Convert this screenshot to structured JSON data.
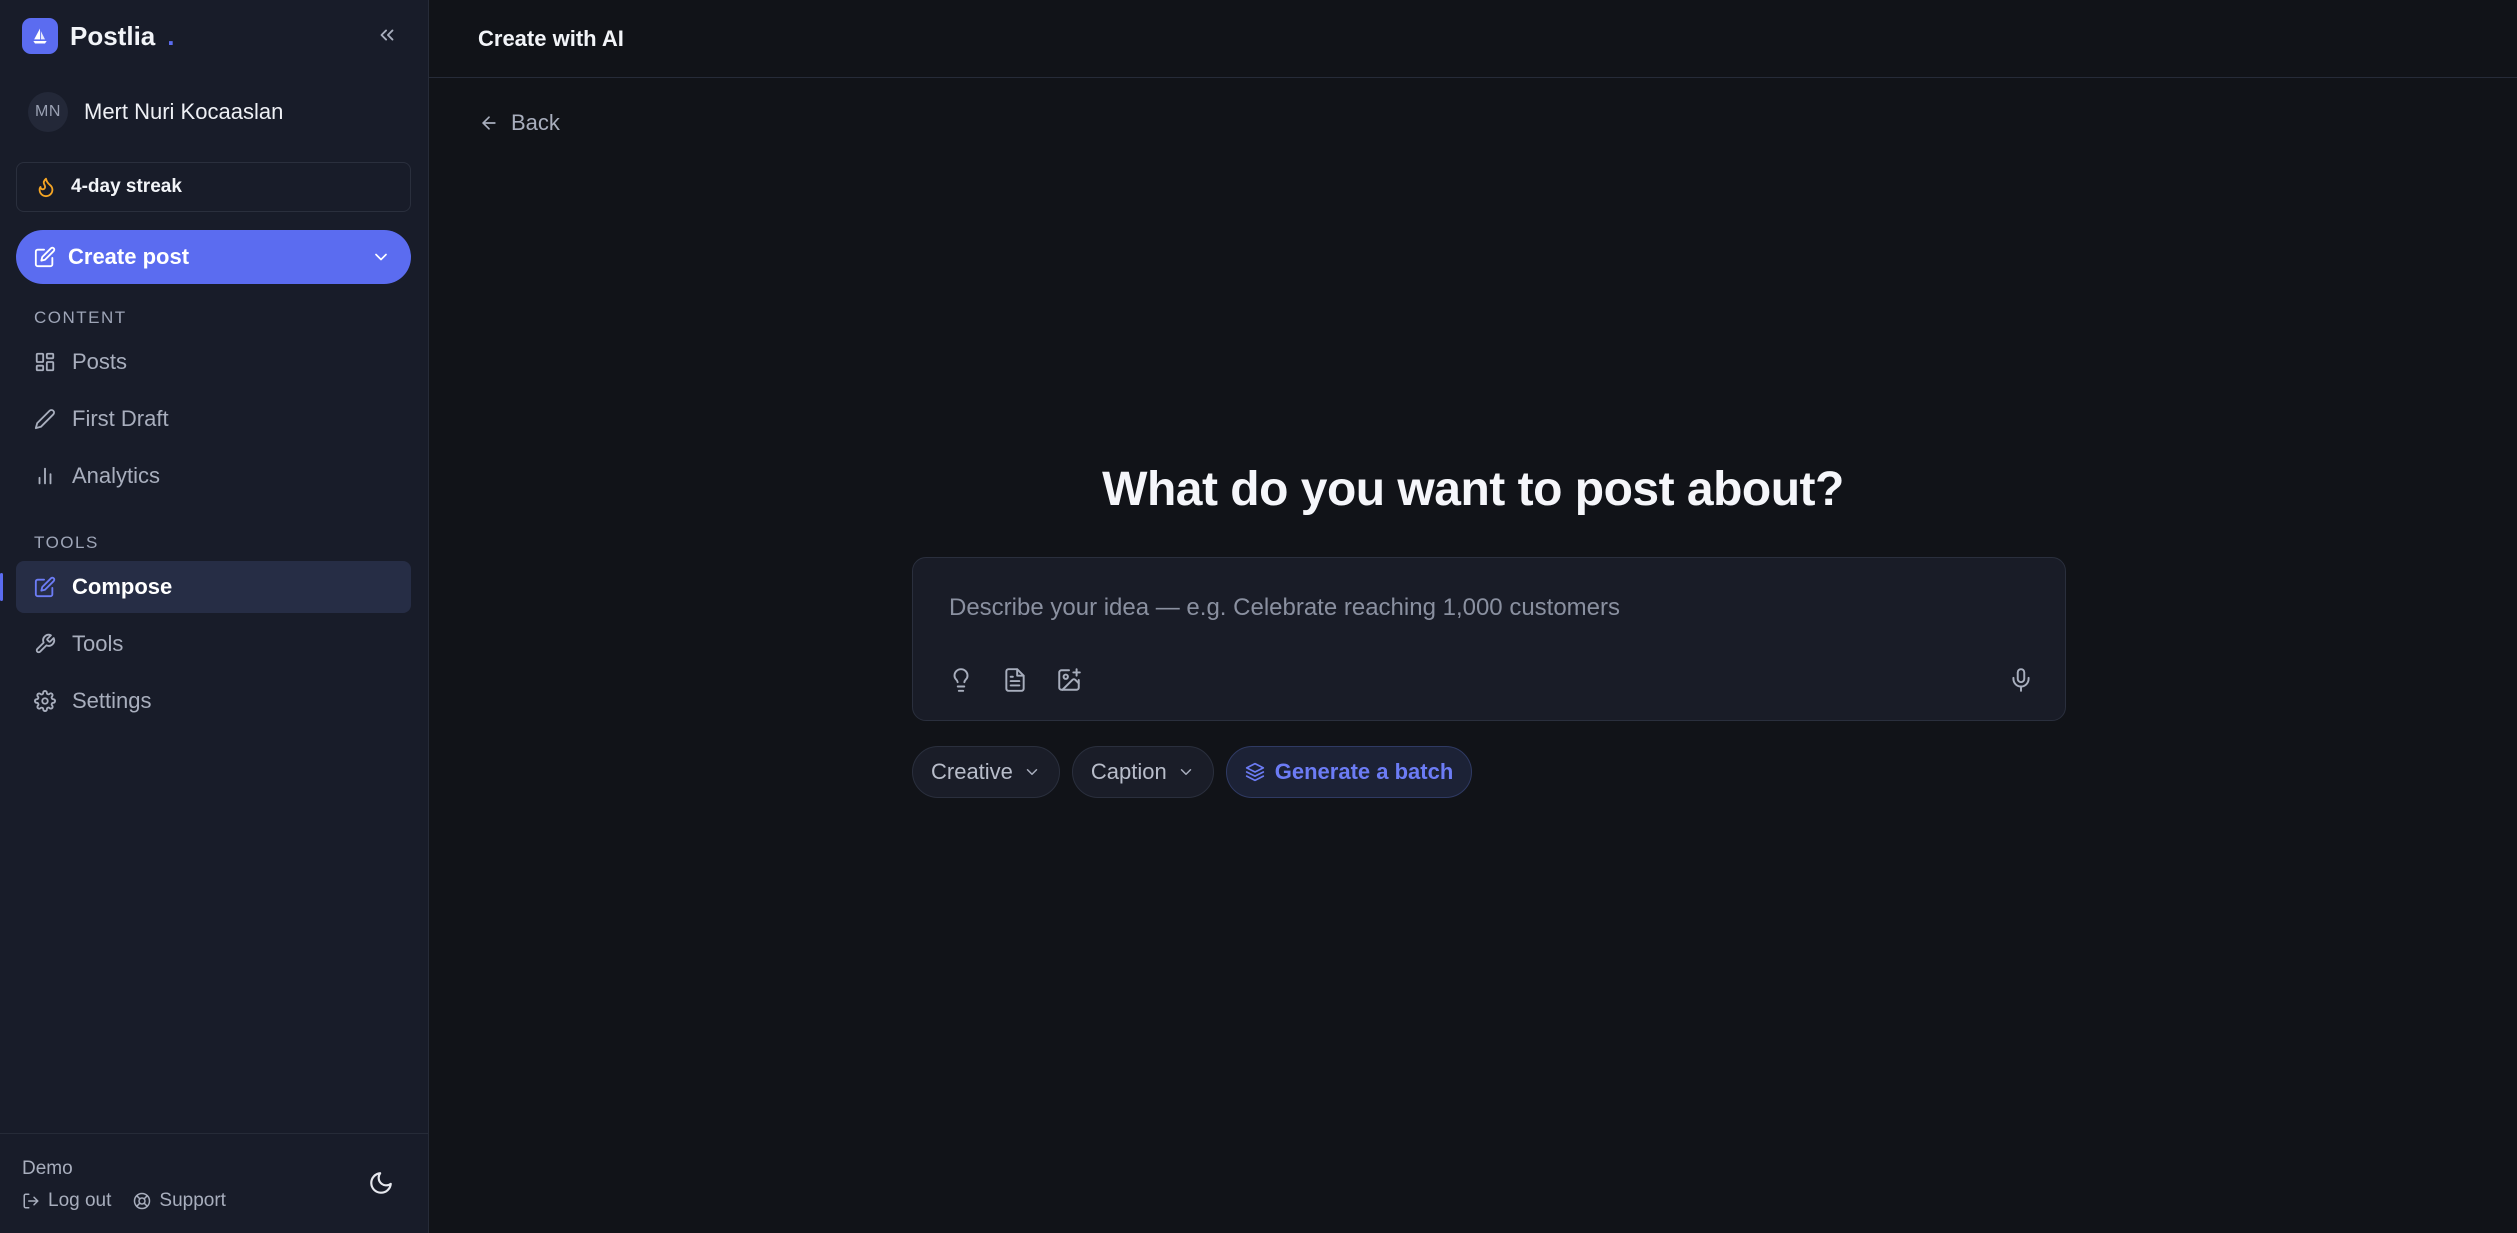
{
  "sidebar": {
    "brand_name": "Postlia",
    "brand_dot": ".",
    "user": {
      "initials": "MN",
      "name": "Mert Nuri Kocaaslan"
    },
    "streak_label": "4-day streak",
    "create_label": "Create post",
    "sections": [
      {
        "label": "CONTENT"
      },
      {
        "label": "TOOLS"
      }
    ],
    "items": [
      {
        "label": "Posts",
        "icon": "grid-icon"
      },
      {
        "label": "First Draft",
        "icon": "pencil-icon"
      },
      {
        "label": "Analytics",
        "icon": "bar-chart-icon"
      },
      {
        "label": "Compose",
        "icon": "edit-icon",
        "active": true
      },
      {
        "label": "Tools",
        "icon": "wrench-icon"
      },
      {
        "label": "Settings",
        "icon": "gear-icon"
      }
    ],
    "footer": {
      "plan": "Demo",
      "logout": "Log out",
      "support": "Support"
    }
  },
  "header": {
    "title": "Create with AI"
  },
  "main": {
    "back_label": "Back",
    "headline": "What do you want to post about?",
    "composer": {
      "value": "",
      "placeholder": "Describe your idea — e.g. Celebrate reaching 1,000 customers"
    },
    "chips": {
      "tone": "Creative",
      "format": "Caption",
      "batch": "Generate a batch"
    }
  },
  "colors": {
    "accent": "#5b6cf0",
    "background": "#111318",
    "sidebar": "#181c29",
    "streak_flame": "#f5a524"
  }
}
